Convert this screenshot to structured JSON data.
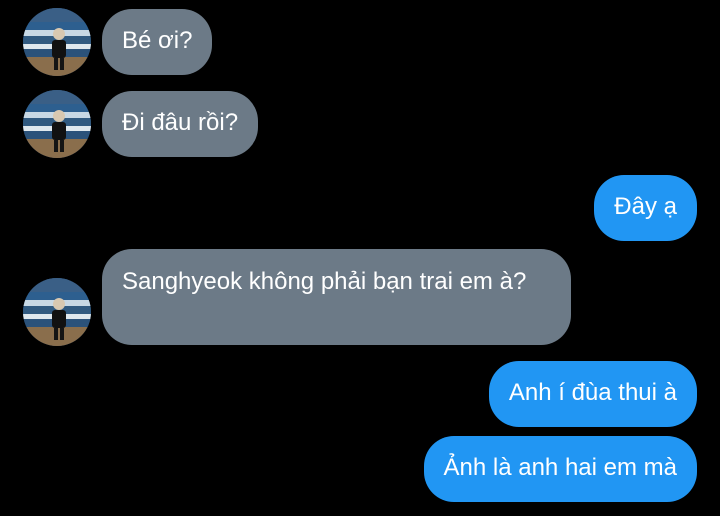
{
  "conversation": {
    "messages": [
      {
        "direction": "incoming",
        "text": "Bé ơi?",
        "avatar": "beach-photo-avatar"
      },
      {
        "direction": "incoming",
        "text": "Đi đâu rồi?",
        "avatar": "beach-photo-avatar"
      },
      {
        "direction": "outgoing",
        "text": "Đây ạ"
      },
      {
        "direction": "incoming",
        "text": "Sanghyeok không phải bạn trai em à?",
        "avatar": "beach-photo-avatar"
      },
      {
        "direction": "outgoing",
        "text": "Anh í đùa thui à"
      },
      {
        "direction": "outgoing",
        "text": "Ảnh là anh hai em mà"
      }
    ]
  },
  "colors": {
    "background": "#000000",
    "incoming_bubble": "#6c7a87",
    "outgoing_bubble": "#2196f3",
    "text": "#ffffff"
  }
}
